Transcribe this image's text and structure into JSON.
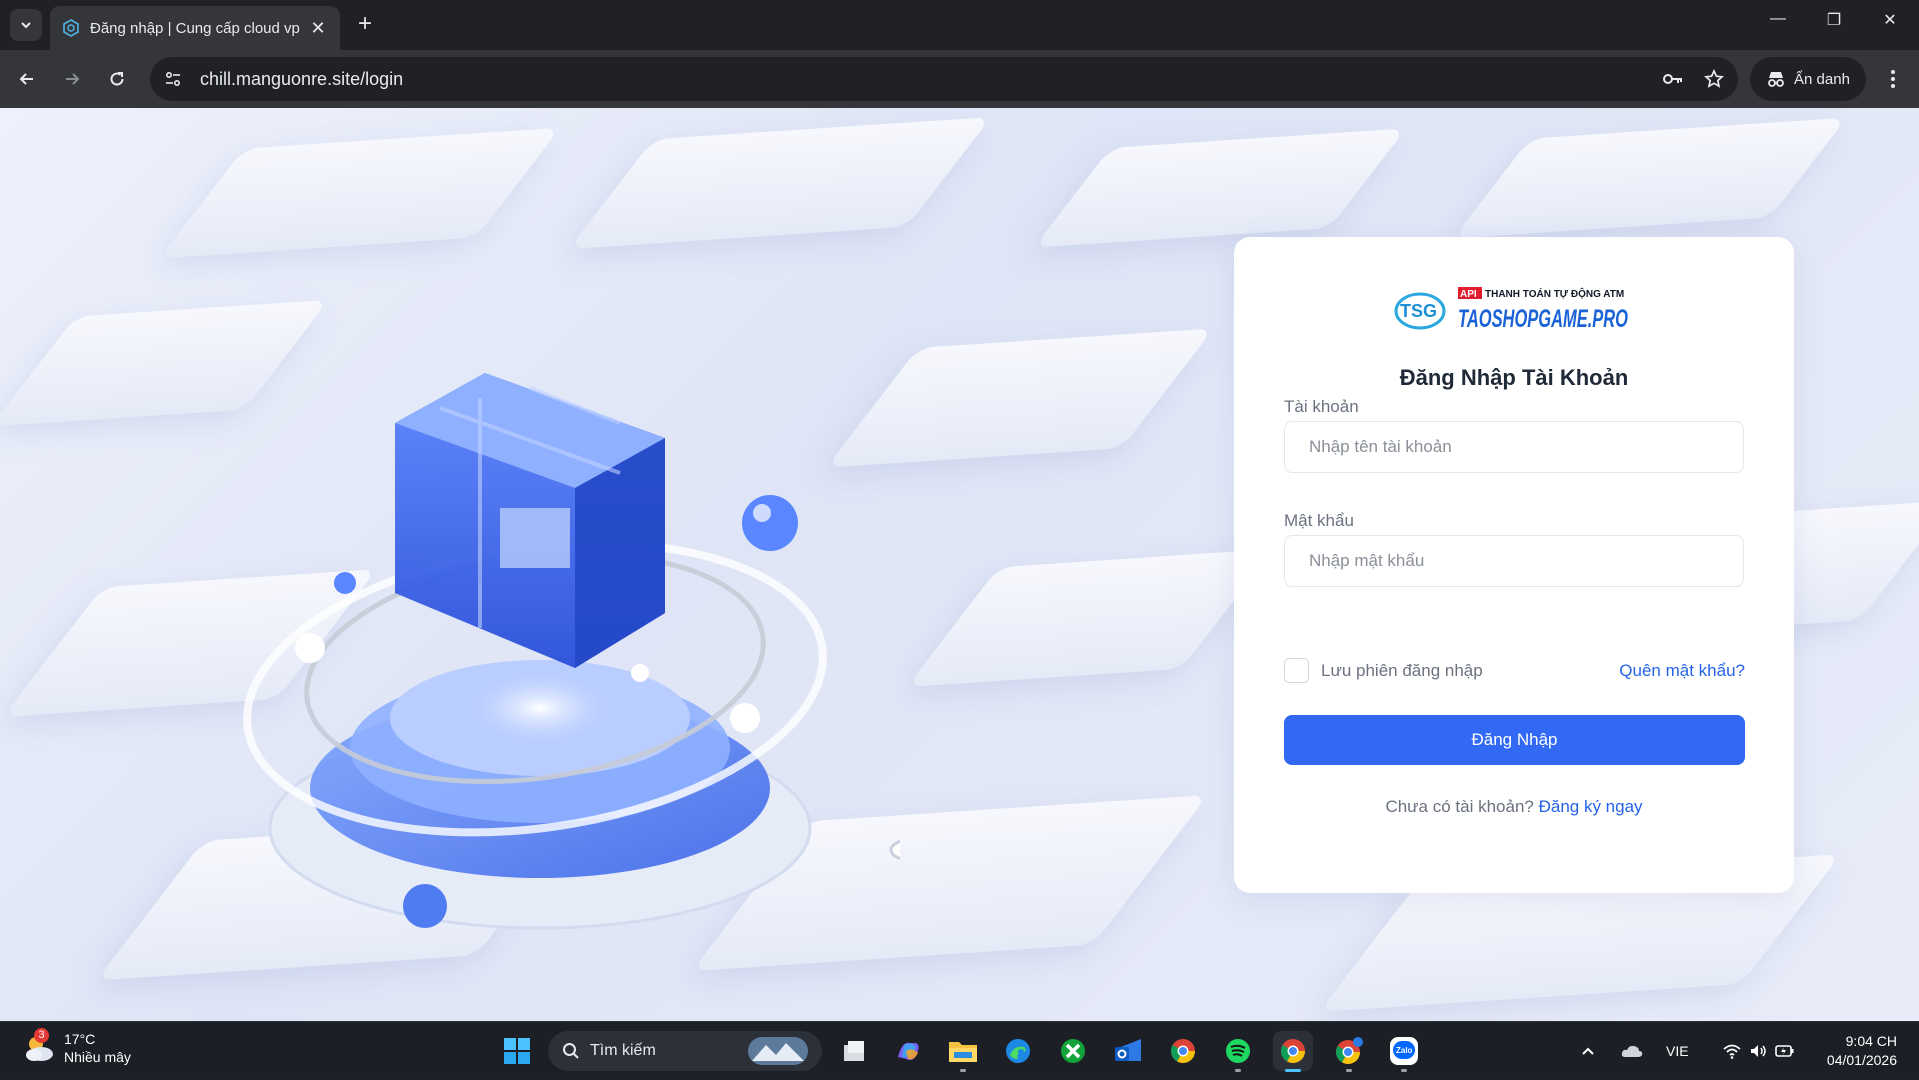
{
  "browser": {
    "tab_title": "Đăng nhập | Cung cấp cloud vp",
    "url": "chill.manguonre.site/login",
    "incognito_label": "Ẩn danh"
  },
  "logo": {
    "abbr": "TSG",
    "tag": "API",
    "tagline": "THANH TOÁN TỰ ĐỘNG ATM",
    "name": "TAOSHOPGAME.PRO"
  },
  "login": {
    "title": "Đăng Nhập Tài Khoản",
    "username_label": "Tài khoản",
    "username_placeholder": "Nhập tên tài khoản",
    "password_label": "Mật khẩu",
    "password_placeholder": "Nhập mật khẩu",
    "remember_label": "Lưu phiên đăng nhập",
    "forgot_label": "Quên mật khẩu?",
    "submit_label": "Đăng Nhập",
    "no_account_text": "Chưa có tài khoản?",
    "register_label": "Đăng ký ngay"
  },
  "taskbar": {
    "weather_badge": "3",
    "temperature": "17°C",
    "weather_desc": "Nhiều mây",
    "search_label": "Tìm kiếm",
    "language": "VIE",
    "time": "9:04 CH",
    "date": "04/01/2026",
    "zalo_label": "Zalo"
  },
  "colors": {
    "primary": "#3169f5",
    "link": "#2563eb",
    "chrome_dark": "#202124",
    "taskbar": "#1c1f26"
  }
}
